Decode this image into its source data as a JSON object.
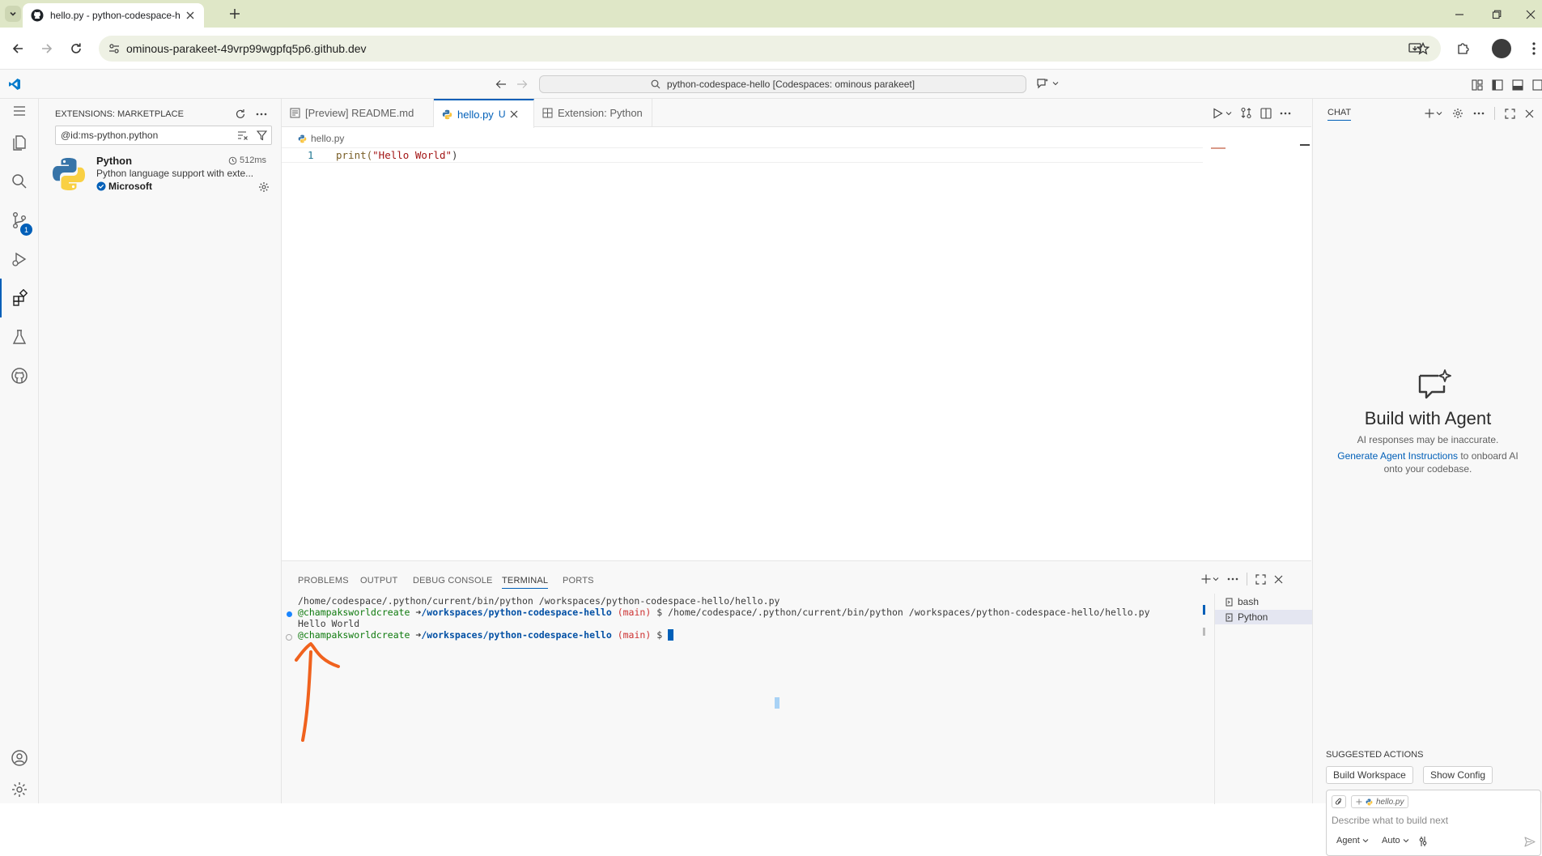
{
  "browser": {
    "tab_title": "hello.py - python-codespace-h",
    "url": "ominous-parakeet-49vrp99wgpfq5p6.github.dev"
  },
  "vscode": {
    "command_center": "python-codespace-hello [Codespaces: ominous parakeet]",
    "activity_badge": "1",
    "sidebar": {
      "title": "EXTENSIONS: MARKETPLACE",
      "search_value": "@id:ms-python.python",
      "extension": {
        "name": "Python",
        "time": "512ms",
        "description": "Python language support with exte...",
        "publisher": "Microsoft"
      }
    },
    "editor": {
      "tabs": [
        {
          "label": "[Preview] README.md"
        },
        {
          "label": "hello.py",
          "status": "U"
        },
        {
          "label": "Extension: Python"
        }
      ],
      "breadcrumb": "hello.py",
      "line_number": "1",
      "code_fn": "print(",
      "code_str": "\"Hello World\"",
      "code_end": ")"
    },
    "panel": {
      "tabs": [
        "PROBLEMS",
        "OUTPUT",
        "DEBUG CONSOLE",
        "TERMINAL",
        "PORTS"
      ],
      "terminal": {
        "line1": "/home/codespace/.python/current/bin/python /workspaces/python-codespace-hello/hello.py",
        "user": "@champaksworldcreate",
        "arrow": "➜",
        "path": "/workspaces/python-codespace-hello",
        "branch": "(main)",
        "prompt": "$",
        "command": "/home/codespace/.python/current/bin/python /workspaces/python-codespace-hello/hello.py",
        "output": "Hello World"
      },
      "terminal_list": [
        "bash",
        "Python"
      ]
    },
    "chat": {
      "header": "CHAT",
      "title": "Build with Agent",
      "disclaimer": "AI responses may be inaccurate.",
      "link_text": "Generate Agent Instructions",
      "link_rest_1": " to onboard AI",
      "link_rest_2": "onto your codebase.",
      "suggested_title": "SUGGESTED ACTIONS",
      "actions": [
        "Build Workspace",
        "Show Config"
      ],
      "context_file": "hello.py",
      "input_placeholder": "Describe what to build next",
      "mode": "Agent",
      "model": "Auto"
    }
  },
  "colors": {
    "accent": "#005fb8",
    "annotation": "#f0621e",
    "terminal_green": "#0e7a0d",
    "terminal_blue": "#0451a5",
    "terminal_red": "#cd3131"
  }
}
